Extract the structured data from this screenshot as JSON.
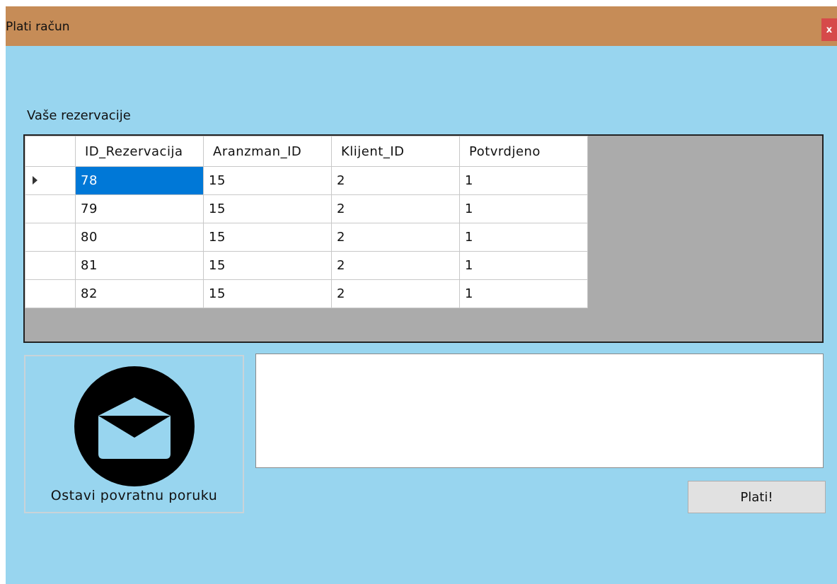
{
  "window": {
    "title": "Plati račun",
    "close_label": "x"
  },
  "reservations": {
    "label": "Vaše rezervacije",
    "columns": [
      "ID_Rezervacija",
      "Aranzman_ID",
      "Klijent_ID",
      "Potvrdjeno"
    ],
    "rows": [
      [
        "78",
        "15",
        "2",
        "1"
      ],
      [
        "79",
        "15",
        "2",
        "1"
      ],
      [
        "80",
        "15",
        "2",
        "1"
      ],
      [
        "81",
        "15",
        "2",
        "1"
      ],
      [
        "82",
        "15",
        "2",
        "1"
      ]
    ],
    "selected_row": 0
  },
  "feedback": {
    "button_label": "Ostavi povratnu poruku",
    "icon": "envelope-icon",
    "message_value": ""
  },
  "pay": {
    "button_label": "Plati!"
  },
  "colors": {
    "titlebar": "#c68c57",
    "background": "#98d5ef",
    "selection": "#0078d7",
    "close": "#d64a4a"
  }
}
